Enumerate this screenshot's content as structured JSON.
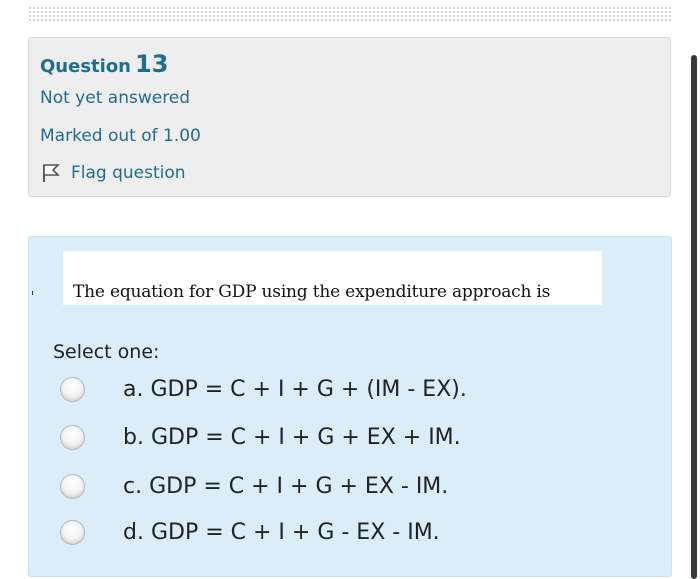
{
  "question": {
    "word": "Question",
    "number": "13",
    "state": "Not yet answered",
    "grade": "Marked out of 1.00",
    "flag_label": "Flag question"
  },
  "content": {
    "question_text": "The equation for GDP using the expenditure approach is",
    "prompt": "Select one:",
    "answers": [
      {
        "letter": "a.",
        "text": "GDP = C + I + G + (IM - EX)."
      },
      {
        "letter": "b.",
        "text": "GDP = C + I + G + EX + IM."
      },
      {
        "letter": "c.",
        "text": "GDP = C + I + G + EX - IM."
      },
      {
        "letter": "d.",
        "text": "GDP = C + I + G - EX - IM."
      }
    ]
  },
  "icons": {
    "flag": "flag-icon",
    "radio": "radio-unchecked-icon"
  }
}
